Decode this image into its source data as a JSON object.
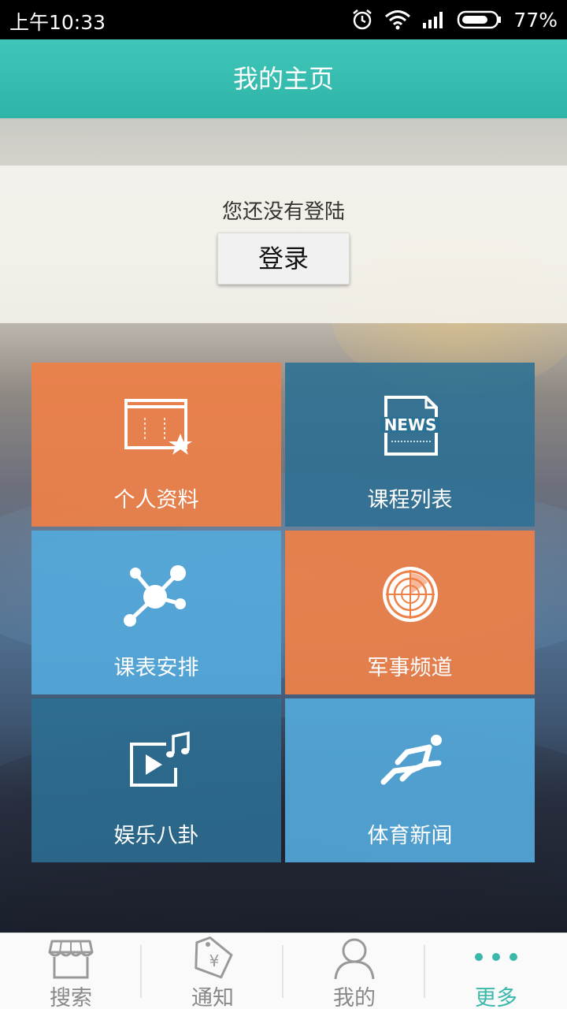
{
  "status_bar": {
    "time": "上午10:33",
    "battery": "77%",
    "icons": [
      "alarm-icon",
      "wifi-icon",
      "signal-icon",
      "battery-icon"
    ]
  },
  "app_bar": {
    "title": "我的主页"
  },
  "login": {
    "message": "您还没有登陆",
    "button": "登录"
  },
  "tiles": [
    {
      "label": "个人资料",
      "icon": "profile-card-star-icon",
      "color": "#ee8048"
    },
    {
      "label": "课程列表",
      "icon": "news-icon",
      "color": "#2c7094"
    },
    {
      "label": "课表安排",
      "icon": "network-icon",
      "color": "#54a8da"
    },
    {
      "label": "军事频道",
      "icon": "radar-icon",
      "color": "#ee8048"
    },
    {
      "label": "娱乐八卦",
      "icon": "video-music-icon",
      "color": "#2c7094"
    },
    {
      "label": "体育新闻",
      "icon": "runner-icon",
      "color": "#54a8da"
    }
  ],
  "bottom_nav": {
    "items": [
      {
        "label": "搜索",
        "icon": "store-icon"
      },
      {
        "label": "通知",
        "icon": "tag-icon"
      },
      {
        "label": "我的",
        "icon": "user-icon"
      },
      {
        "label": "更多",
        "icon": "more-dots-icon"
      }
    ],
    "active": "更多",
    "accent": "#3ab8aa"
  }
}
